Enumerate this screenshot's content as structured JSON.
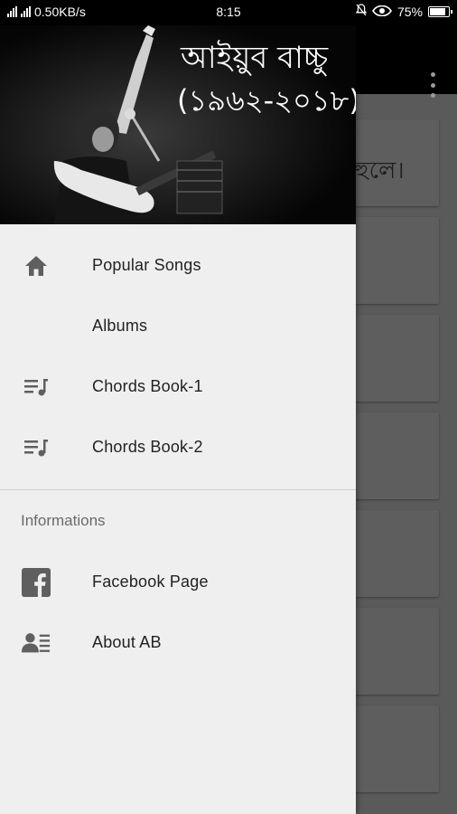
{
  "status_bar": {
    "network_speed": "0.50KB/s",
    "time": "8:15",
    "battery_percent": "75%",
    "battery_level": 0.75
  },
  "drawer": {
    "header": {
      "title": "আইয়ুব বাচ্চু",
      "years": "(১৯৬২-২০১৮)"
    },
    "items": [
      {
        "label": "Popular Songs",
        "icon": "home-icon"
      },
      {
        "label": "Albums",
        "icon": ""
      },
      {
        "label": "Chords Book-1",
        "icon": "playlist-music-icon"
      },
      {
        "label": "Chords Book-2",
        "icon": "playlist-music-icon"
      }
    ],
    "section_title": "Informations",
    "info_items": [
      {
        "label": "Facebook Page",
        "icon": "facebook-icon"
      },
      {
        "label": "About AB",
        "icon": "contact-card-icon"
      }
    ]
  },
  "background": {
    "card_text": "হুলে।"
  },
  "colors": {
    "drawer_bg": "#efefef",
    "header_bg": "#050505",
    "scrim": "#5a5a5a",
    "icon": "#5f5f5f"
  }
}
